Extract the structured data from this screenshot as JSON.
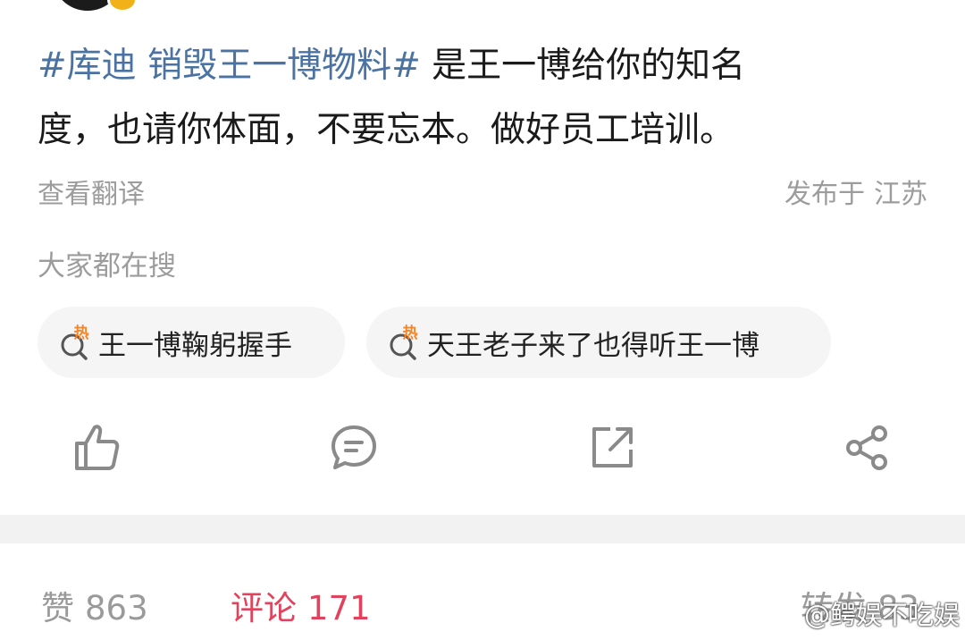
{
  "post": {
    "hashtag": "#库迪 销毁王一博物料#",
    "text_line1": " 是王一博给你的知名",
    "text_line2": "度，也请你体面，不要忘本。做好员工培训。"
  },
  "meta": {
    "translate_label": "查看翻译",
    "location_prefix": "发布于",
    "location": "江苏"
  },
  "search": {
    "title": "大家都在搜",
    "chips": [
      {
        "label": "王一博鞠躬握手",
        "icon": "hot-search-icon",
        "hot_text": "热"
      },
      {
        "label": "天王老子来了也得听王一博",
        "icon": "hot-search-icon",
        "hot_text": "热"
      }
    ]
  },
  "actions": [
    {
      "icon": "thumbs-up-icon"
    },
    {
      "icon": "comment-icon"
    },
    {
      "icon": "repost-icon"
    },
    {
      "icon": "share-icon"
    }
  ],
  "stats": {
    "like_label": "赞",
    "like_count": "863",
    "comment_label": "评论",
    "comment_count": "171",
    "repost_label": "转发",
    "repost_count": "83"
  },
  "watermark": {
    "text": "@鳄娱不吃娱",
    "icon": "weibo-icon"
  },
  "colors": {
    "hashtag": "#4a73a3",
    "comment_active": "#e2425c",
    "hot_badge": "#f0862e",
    "muted": "#9c9c9c",
    "icon_gray": "#8a8a8a"
  }
}
